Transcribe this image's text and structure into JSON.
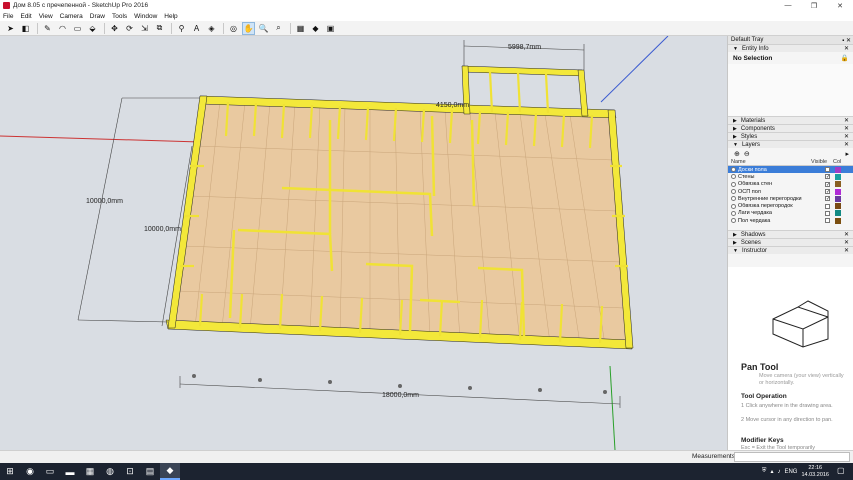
{
  "window": {
    "title": "Дом 8.05 с пречепенной - SketchUp Pro 2016",
    "minimize": "—",
    "maximize": "❐",
    "close": "✕"
  },
  "menu": [
    "File",
    "Edit",
    "View",
    "Camera",
    "Draw",
    "Tools",
    "Window",
    "Help"
  ],
  "toolbar": [
    {
      "name": "select-icon",
      "glyph": "➤"
    },
    {
      "name": "eraser-icon",
      "glyph": "◧"
    },
    {
      "name": "pencil-icon",
      "glyph": "✎"
    },
    {
      "name": "arc-icon",
      "glyph": "◠"
    },
    {
      "name": "rectangle-icon",
      "glyph": "▭"
    },
    {
      "name": "push-pull-icon",
      "glyph": "⬙"
    },
    {
      "name": "move-icon",
      "glyph": "✥"
    },
    {
      "name": "rotate-icon",
      "glyph": "⟳"
    },
    {
      "name": "scale-icon",
      "glyph": "⇲"
    },
    {
      "name": "offset-icon",
      "glyph": "⧉"
    },
    {
      "name": "tape-measure-icon",
      "glyph": "⚲"
    },
    {
      "name": "text-icon",
      "glyph": "A"
    },
    {
      "name": "paint-bucket-icon",
      "glyph": "◈"
    },
    {
      "name": "orbit-icon",
      "glyph": "◎"
    },
    {
      "name": "pan-icon",
      "glyph": "✋"
    },
    {
      "name": "zoom-icon",
      "glyph": "🔍"
    },
    {
      "name": "zoom-extents-icon",
      "glyph": "⌕"
    },
    {
      "name": "warehouse-icon",
      "glyph": "▦"
    },
    {
      "name": "extension-icon",
      "glyph": "◆"
    },
    {
      "name": "layout-icon",
      "glyph": "▣"
    }
  ],
  "viewport": {
    "dimensions": {
      "top": "5998,7mm",
      "inner_top": "4150,0mm",
      "left_outer": "10000,0mm",
      "left_inner": "10000,0mm",
      "bottom": "18000,0mm"
    }
  },
  "measurements": {
    "label": "Measurements",
    "value": ""
  },
  "tray": {
    "title": "Default Tray",
    "entity_info": {
      "label": "Entity Info",
      "selection": "No Selection"
    },
    "panels": [
      "Materials",
      "Components",
      "Styles"
    ],
    "layers": {
      "label": "Layers",
      "col_name": "Name",
      "col_visible": "Visible",
      "col_color": "Col",
      "rows": [
        {
          "name": "Доски пола",
          "visible": true,
          "color": "#a13cc7",
          "selected": true
        },
        {
          "name": "Стены",
          "visible": true,
          "color": "#1aa1a1",
          "selected": false
        },
        {
          "name": "Обвязка стен",
          "visible": true,
          "color": "#8a5f20",
          "selected": false
        },
        {
          "name": "ОСП пол",
          "visible": true,
          "color": "#b02bd6",
          "selected": false
        },
        {
          "name": "Внутренние перегородки",
          "visible": true,
          "color": "#6b3aa0",
          "selected": false
        },
        {
          "name": "Обвязка перегородок",
          "visible": false,
          "color": "#7a4a15",
          "selected": false
        },
        {
          "name": "Лаги чердака",
          "visible": false,
          "color": "#138a83",
          "selected": false
        },
        {
          "name": "Пол чердака",
          "visible": false,
          "color": "#7b4f10",
          "selected": false
        }
      ]
    },
    "bottom_panels": [
      "Shadows",
      "Scenes",
      "Instructor"
    ],
    "instructor": {
      "title": "Pan Tool",
      "desc": "Move camera (your view) vertically or horizontally.",
      "op_heading": "Tool Operation",
      "steps": [
        "1  Click anywhere in the drawing area.",
        "2  Move cursor in any direction to pan."
      ],
      "mod_heading": "Modifier Keys",
      "mod_text": "Esc = Exit the Tool temporarily"
    }
  },
  "taskbar": {
    "lang": "ENG",
    "time": "22:16",
    "date": "14.03.2016"
  }
}
